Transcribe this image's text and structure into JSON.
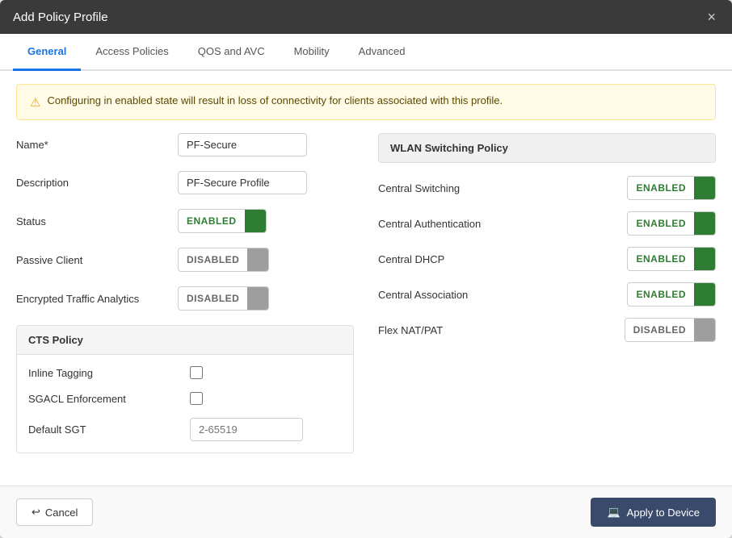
{
  "modal": {
    "title": "Add Policy Profile",
    "close_label": "×"
  },
  "tabs": [
    {
      "label": "General",
      "active": true
    },
    {
      "label": "Access Policies",
      "active": false
    },
    {
      "label": "QOS and AVC",
      "active": false
    },
    {
      "label": "Mobility",
      "active": false
    },
    {
      "label": "Advanced",
      "active": false
    }
  ],
  "warning": {
    "text": "Configuring in enabled state will result in loss of connectivity for clients associated with this profile."
  },
  "form": {
    "name_label": "Name*",
    "name_value": "PF-Secure",
    "description_label": "Description",
    "description_value": "PF-Secure Profile",
    "status_label": "Status",
    "status_value": "ENABLED",
    "passive_client_label": "Passive Client",
    "passive_client_value": "DISABLED",
    "eta_label": "Encrypted Traffic Analytics",
    "eta_value": "DISABLED"
  },
  "cts_policy": {
    "section_label": "CTS Policy",
    "inline_tagging_label": "Inline Tagging",
    "sgacl_label": "SGACL Enforcement",
    "default_sgt_label": "Default SGT",
    "default_sgt_placeholder": "2-65519"
  },
  "wlan": {
    "header": "WLAN Switching Policy",
    "rows": [
      {
        "label": "Central Switching",
        "value": "ENABLED",
        "enabled": true
      },
      {
        "label": "Central Authentication",
        "value": "ENABLED",
        "enabled": true
      },
      {
        "label": "Central DHCP",
        "value": "ENABLED",
        "enabled": true
      },
      {
        "label": "Central Association",
        "value": "ENABLED",
        "enabled": true
      },
      {
        "label": "Flex NAT/PAT",
        "value": "DISABLED",
        "enabled": false
      }
    ]
  },
  "footer": {
    "cancel_label": "Cancel",
    "apply_label": "Apply to Device",
    "cancel_icon": "↩",
    "apply_icon": "🖥"
  }
}
